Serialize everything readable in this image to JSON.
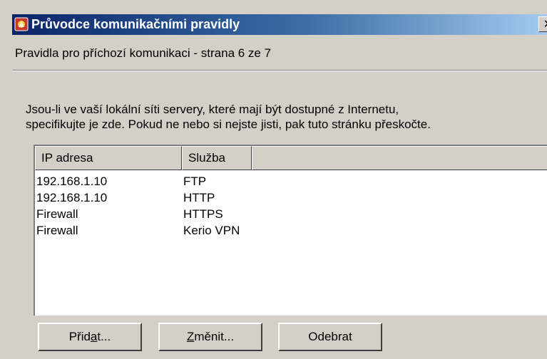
{
  "window": {
    "title": "Průvodce komunikačními pravidly",
    "close_glyph": "✕",
    "icon": "wizard-app-icon",
    "colors": {
      "titlebar_start": "#0a246a",
      "titlebar_end": "#a6caf0",
      "face": "#d4d0c8"
    }
  },
  "header": {
    "subtitle": "Pravidla pro příchozí komunikaci - strana 6 ze 7"
  },
  "body": {
    "description_line1": "Jsou-li ve vaší lokální síti servery, které mají být dostupné z Internetu,",
    "description_line2": "specifikujte je zde. Pokud ne nebo si nejste jisti, pak tuto stránku přeskočte."
  },
  "table": {
    "columns": [
      "IP adresa",
      "Služba",
      ""
    ],
    "rows": [
      {
        "ip": "192.168.1.10",
        "service": "FTP"
      },
      {
        "ip": "192.168.1.10",
        "service": "HTTP"
      },
      {
        "ip": "Firewall",
        "service": "HTTPS"
      },
      {
        "ip": "Firewall",
        "service": "Kerio VPN"
      }
    ]
  },
  "buttons": {
    "add": {
      "before": "Přid",
      "mnemonic": "a",
      "after": "t..."
    },
    "change": {
      "before": "",
      "mnemonic": "Z",
      "after": "měnit..."
    },
    "remove": "Odebrat"
  }
}
